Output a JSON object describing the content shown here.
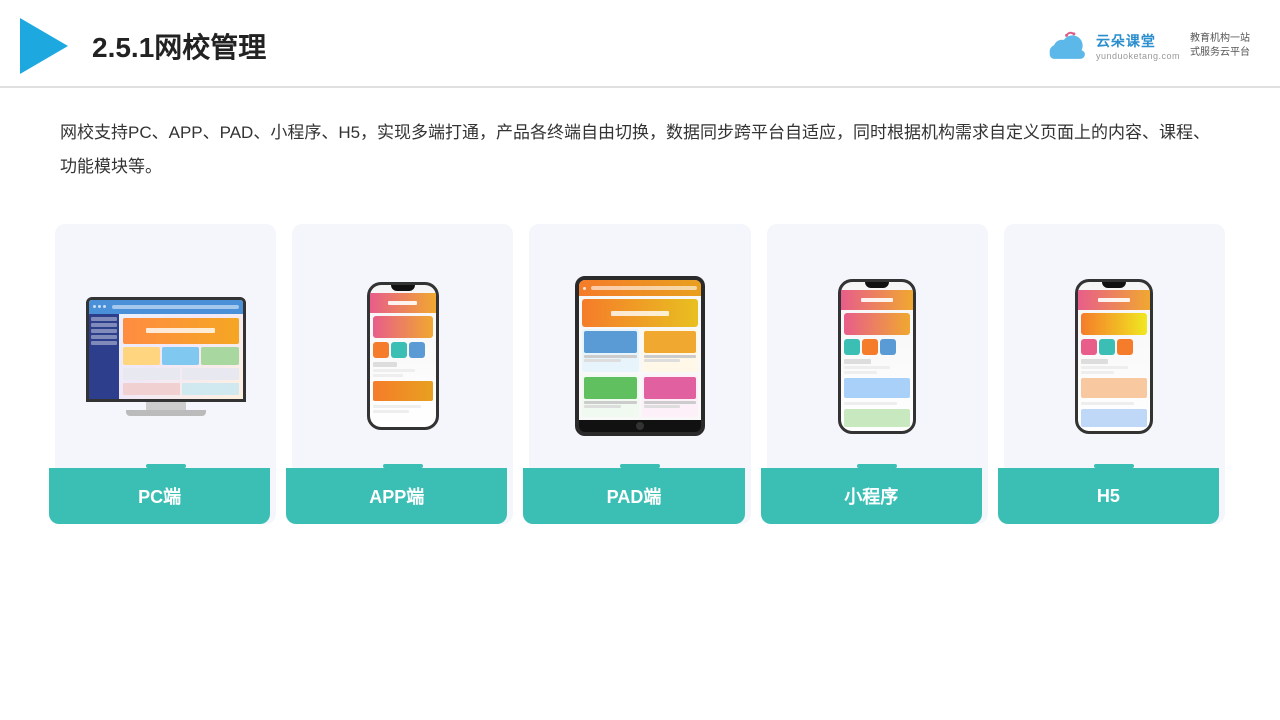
{
  "header": {
    "title": "2.5.1网校管理",
    "brand": {
      "name": "云朵课堂",
      "url": "yunduoketang.com",
      "slogan": "教育机构一站\n式服务云平台"
    }
  },
  "description": "网校支持PC、APP、PAD、小程序、H5，实现多端打通，产品各终端自由切换，数据同步跨平台自适应，同时根据机构需求自定义页面上的内容、课程、功能模块等。",
  "cards": [
    {
      "id": "pc",
      "label": "PC端"
    },
    {
      "id": "app",
      "label": "APP端"
    },
    {
      "id": "pad",
      "label": "PAD端"
    },
    {
      "id": "mini",
      "label": "小程序"
    },
    {
      "id": "h5",
      "label": "H5"
    }
  ],
  "colors": {
    "accent": "#3bbfb5",
    "header_line": "#e0e0e0",
    "title": "#222",
    "description": "#333",
    "card_bg": "#f4f6fb"
  }
}
